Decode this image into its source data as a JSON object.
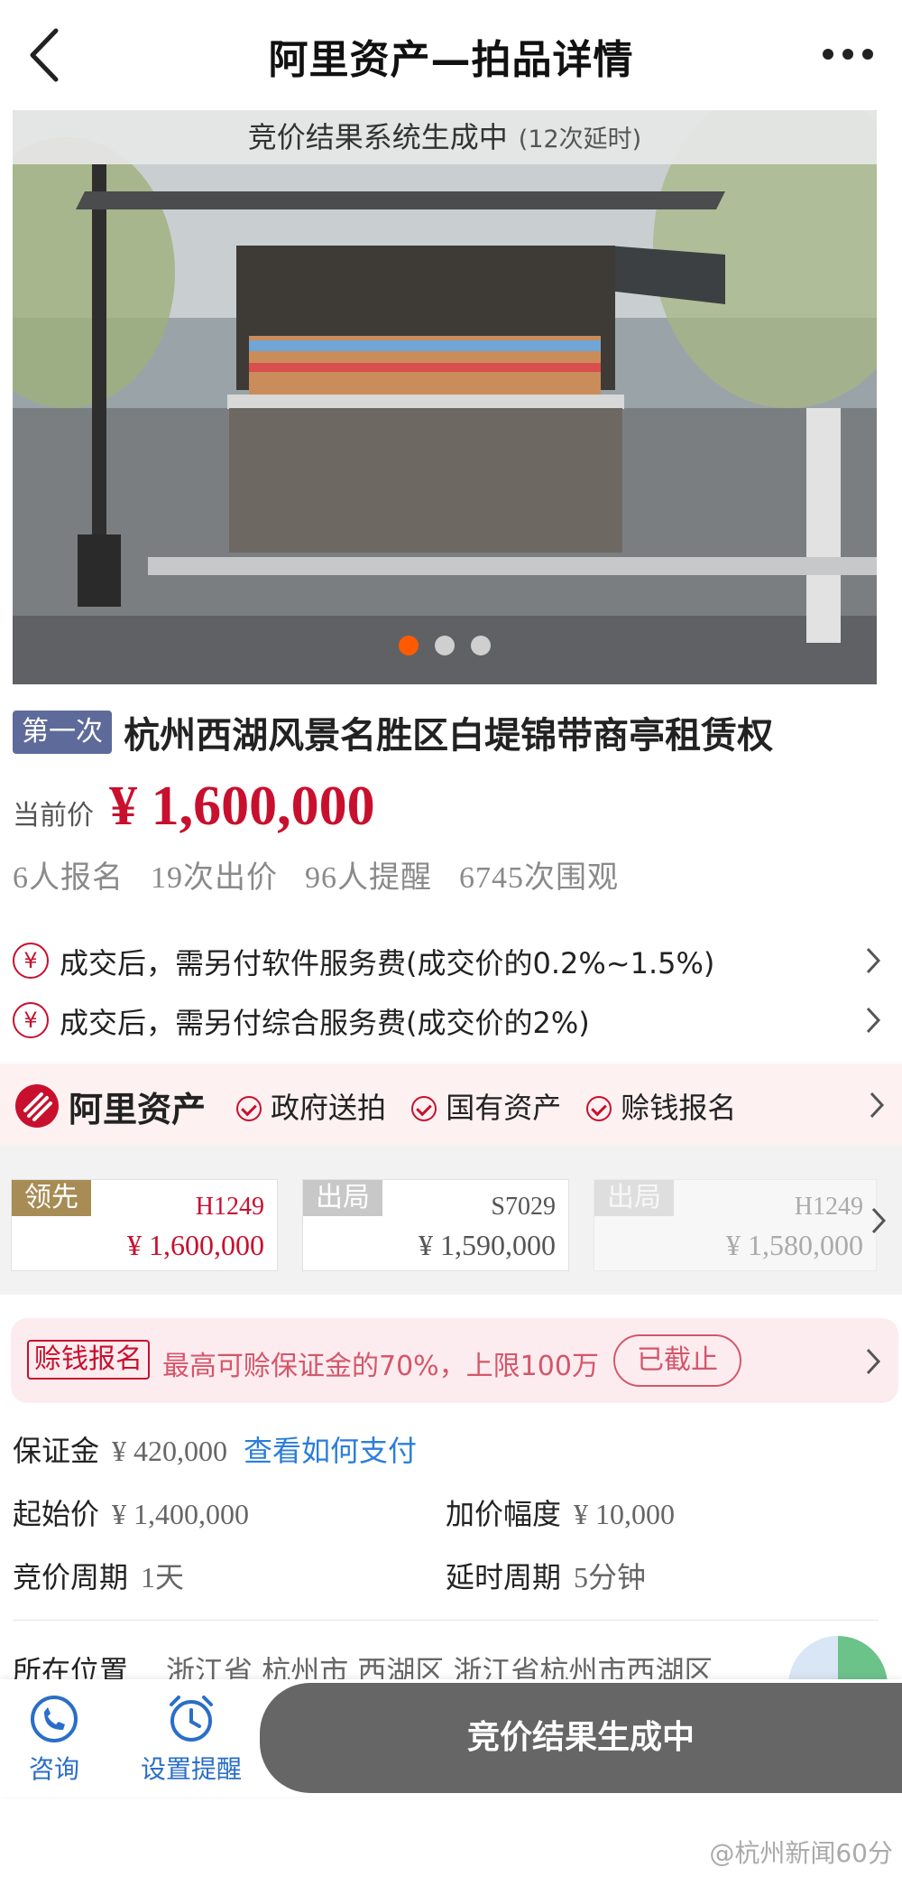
{
  "nav": {
    "title": "阿里资产—拍品详情"
  },
  "gallery": {
    "banner_main": "竞价结果系统生成中",
    "banner_sub": "(12次延时)",
    "dot_count": 3,
    "active_dot": 0
  },
  "lot": {
    "round_badge": "第一次",
    "title": "杭州西湖风景名胜区白堤锦带商亭租赁权",
    "current_price_label": "当前价",
    "current_price": "¥ 1,600,000",
    "stats": [
      "6人报名",
      "19次出价",
      "96人提醒",
      "6745次围观"
    ]
  },
  "fees": [
    {
      "icon": "¥",
      "text": "成交后，需另付软件服务费(成交价的0.2%~1.5%)"
    },
    {
      "icon": "¥",
      "text": "成交后，需另付综合服务费(成交价的2%)"
    }
  ],
  "brand": {
    "name": "阿里资产",
    "tags": [
      "政府送拍",
      "国有资产",
      "赊钱报名"
    ]
  },
  "bids": [
    {
      "status": "领先",
      "bidder": "H1249",
      "amount": "¥ 1,600,000"
    },
    {
      "status": "出局",
      "bidder": "S7029",
      "amount": "¥ 1,590,000"
    },
    {
      "status": "出局",
      "bidder": "H1249",
      "amount": "¥ 1,580,000"
    }
  ],
  "promo": {
    "tag": "赊钱报名",
    "text": "最高可赊保证金的70%，上限100万",
    "button": "已截止"
  },
  "info": {
    "deposit_label": "保证金",
    "deposit_value": "¥ 420,000",
    "deposit_link": "查看如何支付",
    "start_label": "起始价",
    "start_value": "¥ 1,400,000",
    "increment_label": "加价幅度",
    "increment_value": "¥ 10,000",
    "period_label": "竞价周期",
    "period_value": "1天",
    "delay_label": "延时周期",
    "delay_value": "5分钟",
    "location_label": "所在位置",
    "location_value": "浙江省 杭州市 西湖区 浙江省杭州市西湖区"
  },
  "bottom": {
    "consult": "咨询",
    "reminder": "设置提醒",
    "status": "竞价结果生成中"
  },
  "watermark": "@杭州新闻60分",
  "colors": {
    "accent": "#c8102e",
    "lead": "#a88c55",
    "link": "#2a7ed8",
    "active_dot": "#ff5a00"
  }
}
